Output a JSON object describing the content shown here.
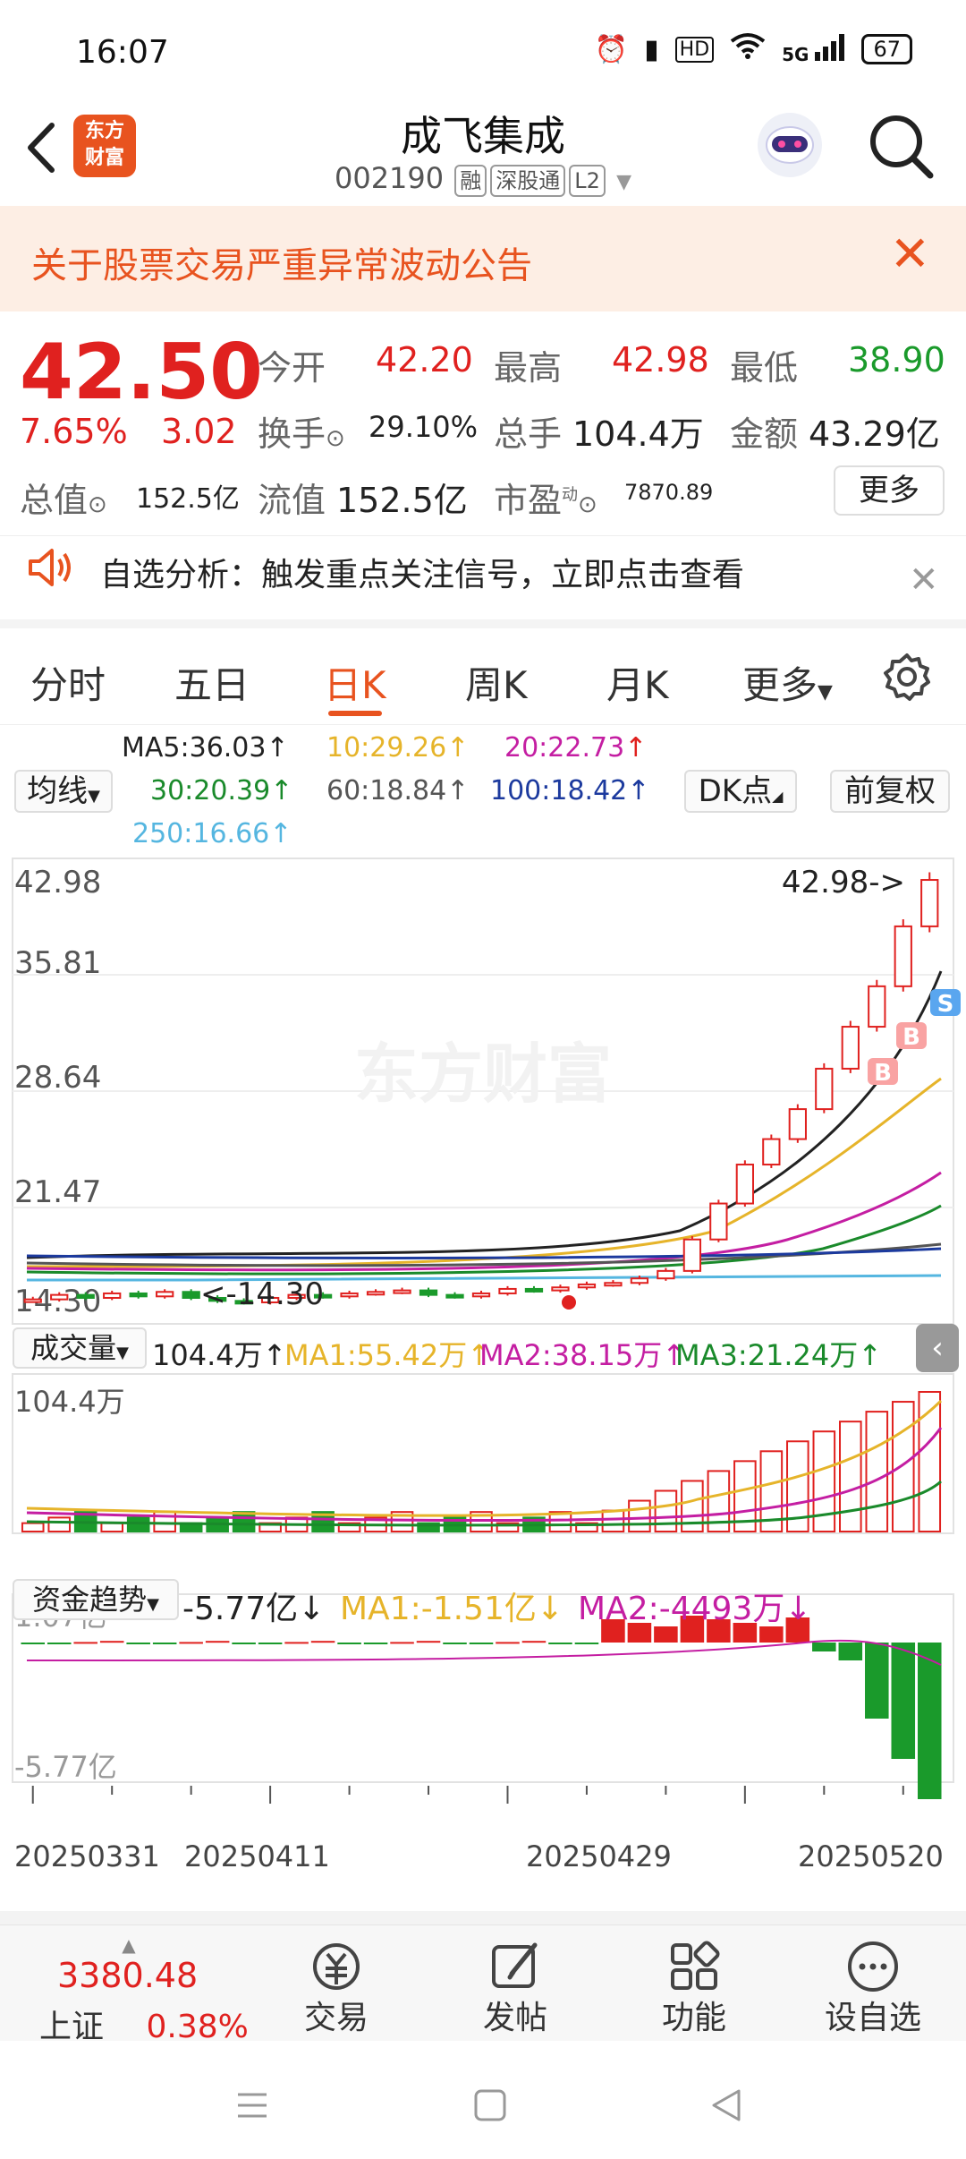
{
  "status": {
    "time": "16:07",
    "network": "5G",
    "hd": "HD",
    "battery": "67"
  },
  "header": {
    "logo_l1": "东方",
    "logo_l2": "财富",
    "title": "成飞集成",
    "code": "002190",
    "tags": [
      "融",
      "深股通",
      "L2"
    ]
  },
  "notice": {
    "text": "关于股票交易严重异常波动公告"
  },
  "quote": {
    "price": "42.50",
    "pct": "7.65%",
    "chg": "3.02",
    "open_label": "今开",
    "open": "42.20",
    "high_label": "最高",
    "high": "42.98",
    "low_label": "最低",
    "low": "38.90",
    "turnover_label": "换手",
    "turnover": "29.10%",
    "vol_label": "总手",
    "vol": "104.4万",
    "amt_label": "金额",
    "amt": "43.29亿",
    "mcap_label": "总值",
    "mcap": "152.5亿",
    "float_label": "流值",
    "float": "152.5亿",
    "pe_label": "市盈",
    "pe_sup": "动",
    "pe": "7870.89",
    "more": "更多"
  },
  "analysis": {
    "text": "自选分析：触发重点关注信号，立即点击查看"
  },
  "tabs": [
    "分时",
    "五日",
    "日K",
    "周K",
    "月K",
    "更多"
  ],
  "ma": {
    "selector": "均线",
    "ma5": "MA5:36.03",
    "ma10": "10:29.26",
    "ma20": "20:22.73",
    "ma30": "30:20.39",
    "ma60": "60:18.84",
    "ma100": "100:18.42",
    "ma250": "250:16.66",
    "dk": "DK点",
    "fq": "前复权"
  },
  "kline": {
    "y_labels": [
      "42.98",
      "35.81",
      "28.64",
      "21.47",
      "14.30"
    ],
    "high_label": "42.98->",
    "low_label": "<-14.30",
    "watermark": "东方财富",
    "buy": "B",
    "sell": "S"
  },
  "volume": {
    "selector": "成交量",
    "value": "104.4万",
    "ma1": "MA1:55.42万",
    "ma2": "MA2:38.15万",
    "ma3": "MA3:21.24万",
    "top": "104.4万"
  },
  "fund": {
    "selector": "资金趋势",
    "value": "-5.77亿",
    "ma1": "MA1:-1.51亿",
    "ma2": "MA2:-4493万",
    "top": "1.07亿",
    "bottom": "-5.77亿"
  },
  "dates": [
    "20250331",
    "20250411",
    "20250429",
    "20250520"
  ],
  "colors": {
    "up": "#e0211f",
    "down": "#1a9a2b",
    "accent": "#e8531f"
  },
  "chart_data": {
    "type": "bar",
    "categories": [
      "20250331",
      "20250411",
      "20250429",
      "20250520"
    ],
    "series": [
      {
        "values": [
          14.5,
          14.8,
          14.6,
          14.9,
          14.7,
          15.0,
          14.6,
          14.4,
          14.3,
          14.6,
          14.8,
          14.7,
          14.9,
          15.0,
          15.1,
          14.8,
          14.7,
          14.9,
          15.2,
          15.1,
          15.3,
          15.5,
          15.6,
          15.9,
          16.4,
          18.5,
          20.9,
          23.5,
          25.2,
          27.2,
          29.9,
          32.7,
          35.4,
          39.4,
          42.5
        ]
      }
    ],
    "ylim": [
      14.3,
      42.98
    ]
  },
  "bottom": {
    "index_value": "3380.48",
    "index_name": "上证",
    "index_pct": "0.38%",
    "trade": "交易",
    "post": "发帖",
    "func": "功能",
    "settings": "设自选"
  }
}
